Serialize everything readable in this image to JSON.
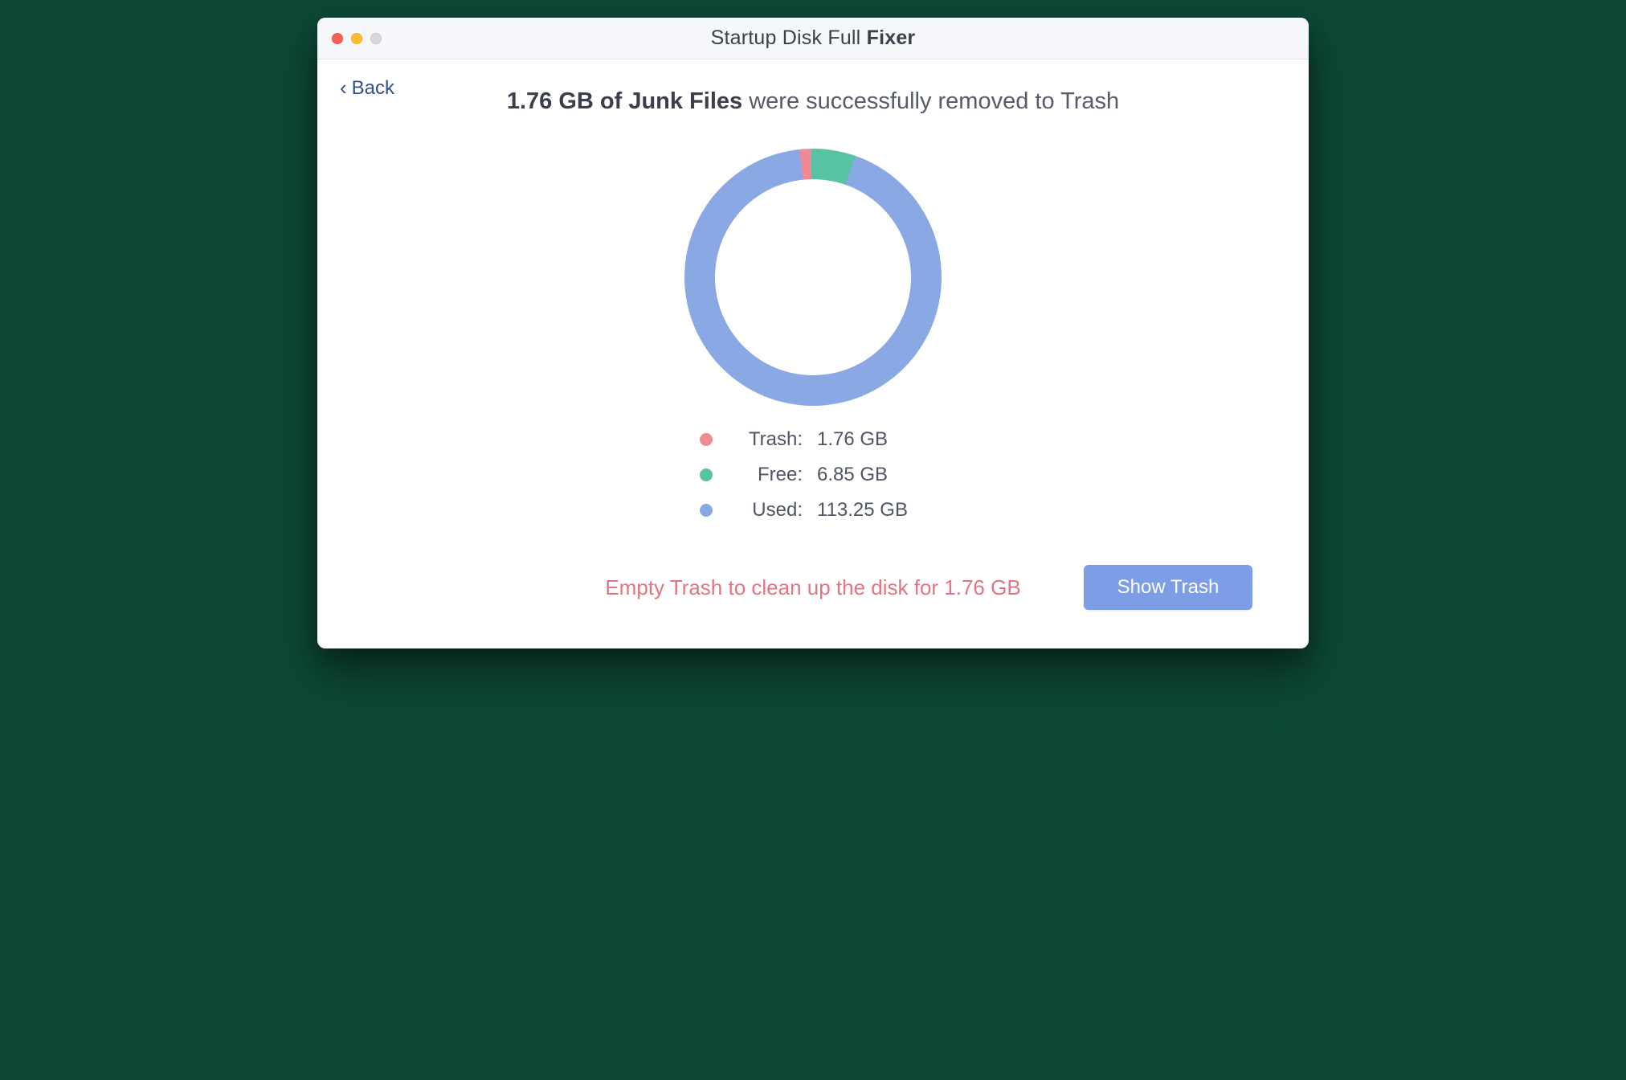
{
  "window": {
    "title_light": "Startup Disk Full",
    "title_bold": "Fixer",
    "back_label": "Back"
  },
  "headline": {
    "strong": "1.76 GB of Junk Files",
    "rest": " were successfully removed to Trash"
  },
  "legend": {
    "items": [
      {
        "key": "trash",
        "label": "Trash:",
        "value": "1.76 GB"
      },
      {
        "key": "free",
        "label": "Free:",
        "value": "6.85 GB"
      },
      {
        "key": "used",
        "label": "Used:",
        "value": "113.25 GB"
      }
    ]
  },
  "footer": {
    "hint": "Empty Trash to clean up the disk for 1.76 GB",
    "button": "Show Trash"
  },
  "colors": {
    "trash": "#ed8a93",
    "free": "#57c2a4",
    "used": "#8aa8e4"
  },
  "chart_data": {
    "type": "pie",
    "title": "",
    "series": [
      {
        "name": "Trash",
        "value": 1.76,
        "unit": "GB",
        "color": "#ed8a93"
      },
      {
        "name": "Free",
        "value": 6.85,
        "unit": "GB",
        "color": "#57c2a4"
      },
      {
        "name": "Used",
        "value": 113.25,
        "unit": "GB",
        "color": "#8aa8e4"
      }
    ],
    "donut_inner_ratio": 0.76,
    "start_angle_deg": -6
  }
}
